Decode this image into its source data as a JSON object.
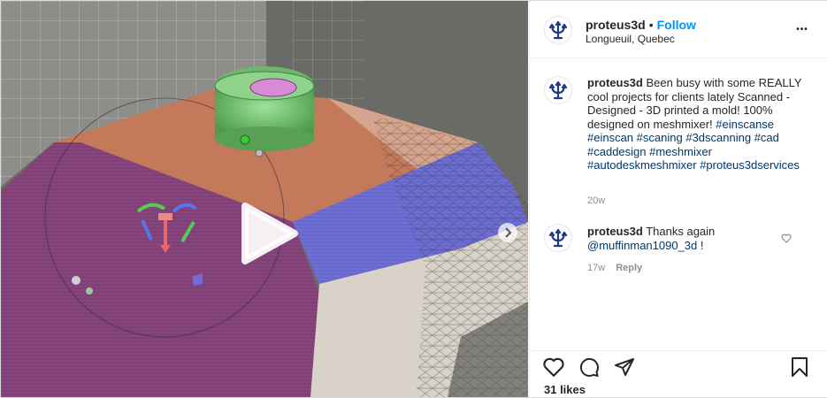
{
  "post": {
    "username": "proteus3d",
    "separator": "•",
    "follow_label": "Follow",
    "location": "Longueuil, Quebec",
    "more_label": "•••"
  },
  "caption": {
    "username": "proteus3d",
    "text": "Been busy with some REALLY cool projects for clients lately Scanned - Designed - 3D printed a mold! 100% designed on meshmixer!",
    "hashtags": [
      "#einscanse",
      "#einscan",
      "#scaning",
      "#3dscanning",
      "#cad",
      "#caddesign",
      "#meshmixer",
      "#autodeskmeshmixer",
      "#proteus3dservices"
    ],
    "age": "20w"
  },
  "comment": {
    "username": "proteus3d",
    "text": "Thanks again",
    "mention": "@muffinman1090_3d",
    "suffix": "!",
    "age": "17w",
    "reply_label": "Reply"
  },
  "footer": {
    "likes": "31 likes"
  },
  "icons": {
    "avatar": "trident-logo-icon",
    "play": "play-icon",
    "next": "chevron-right-icon",
    "like": "heart-icon",
    "comment": "comment-bubble-icon",
    "share": "paper-plane-icon",
    "save": "bookmark-icon",
    "more": "more-dots-icon"
  },
  "colors": {
    "follow": "#0095f6",
    "hashtag": "#00376b",
    "muted": "#8e8e8e",
    "avatar_logo": "#1f3a8a"
  }
}
